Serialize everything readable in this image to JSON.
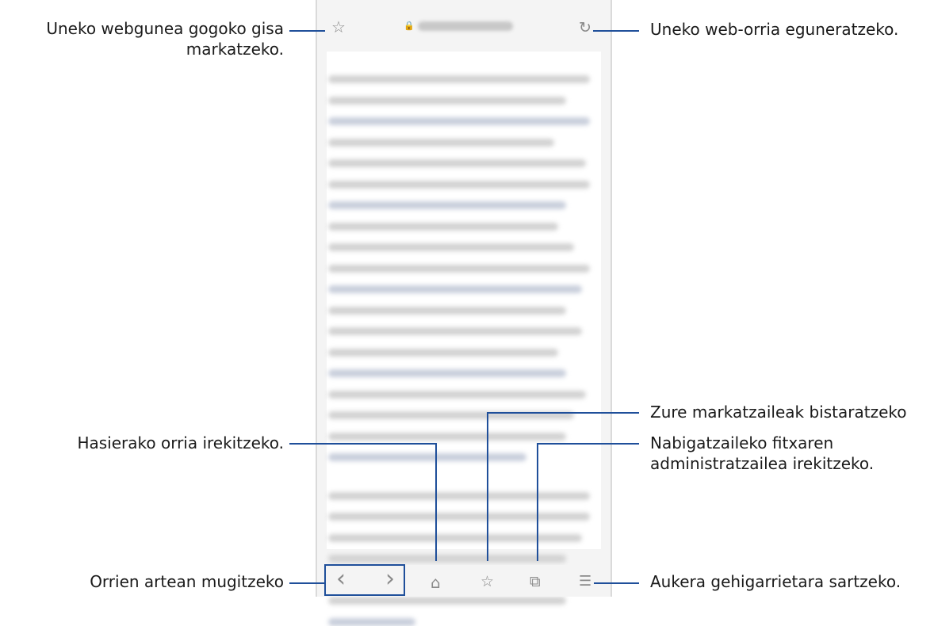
{
  "labels": {
    "bookmark_current": "Uneko webgunea gogoko gisa markatzeko.",
    "refresh": "Uneko web-orria eguneratzeko.",
    "view_bookmarks": "Zure markatzaileak bistaratzeko",
    "open_homepage": "Hasierako orria irekitzeko.",
    "open_tab_manager": "Nabigatzaileko fitxaren administratzailea irekitzeko.",
    "move_between_pages": "Orrien artean mugitzeko",
    "access_more_options": "Aukera gehigarrietara sartzeko."
  },
  "icons": {
    "star": "☆",
    "lock": "🔒",
    "refresh": "↻",
    "back": "‹",
    "forward": "›",
    "home": "⌂",
    "bookmarks": "☆",
    "tabs": "⧉",
    "menu": "☰"
  },
  "colors": {
    "leader": "#1f4f9a",
    "icon": "#8a8a8a"
  }
}
